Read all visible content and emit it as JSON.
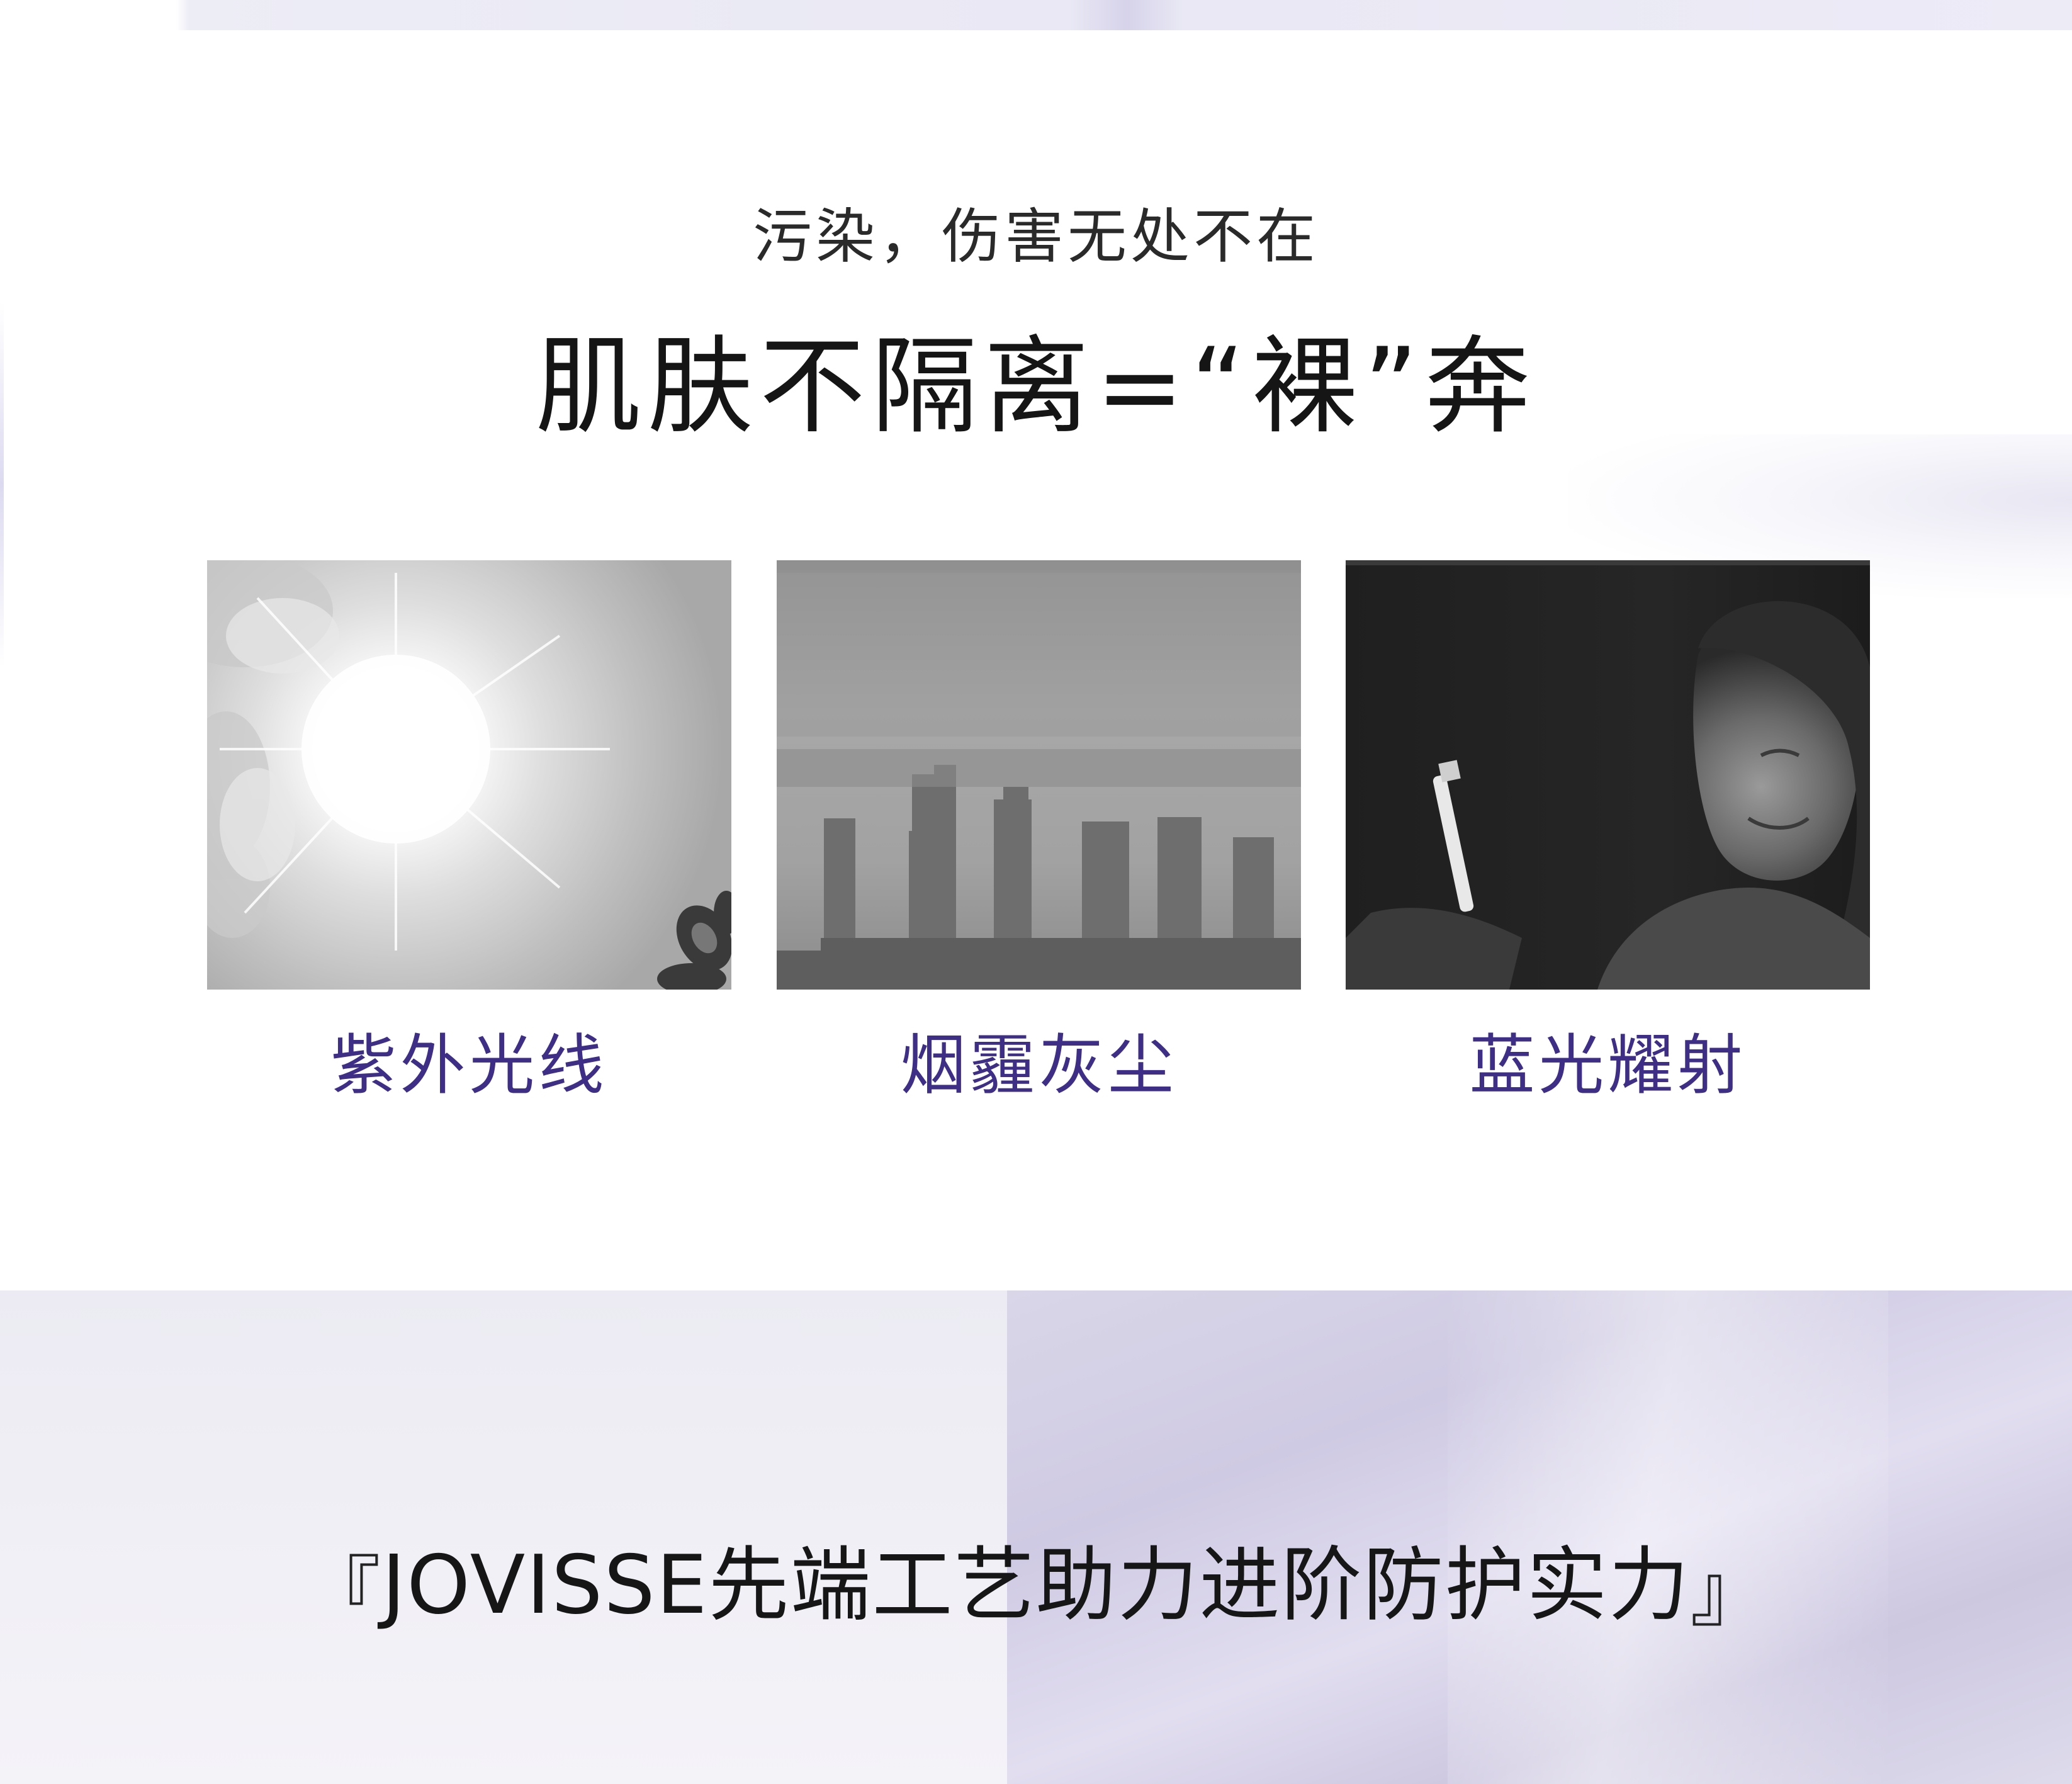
{
  "header": {
    "subtitle": "污染，伤害无处不在",
    "headline": "肌肤不隔离=“裸”奔"
  },
  "threats": [
    {
      "label": "紫外光线",
      "image": "sun-glare-photo"
    },
    {
      "label": "烟霾灰尘",
      "image": "smoggy-city-photo"
    },
    {
      "label": "蓝光耀射",
      "image": "phone-screen-at-night-photo"
    }
  ],
  "tagline": {
    "open_bracket": "『",
    "text": "JOVISSE先端工艺助力进阶防护实力",
    "close_bracket": "』"
  },
  "colors": {
    "caption": "#3f2e86",
    "heading": "#151515",
    "bottom_panel": "#d9d6e8"
  }
}
